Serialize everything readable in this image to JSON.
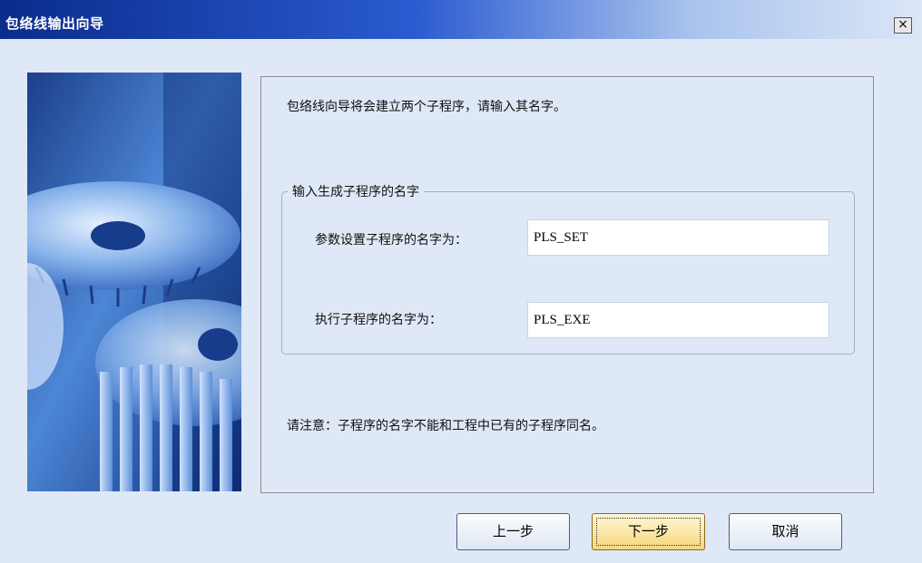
{
  "window": {
    "title": "包络线输出向导",
    "close_glyph": "×"
  },
  "intro_text": "包络线向导将会建立两个子程序，请输入其名字。",
  "group": {
    "legend": "输入生成子程序的名字",
    "set_label": "参数设置子程序的名字为：",
    "set_value": "PLS_SET",
    "exe_label": "执行子程序的名字为：",
    "exe_value": "PLS_EXE"
  },
  "note_text": "请注意：子程序的名字不能和工程中已有的子程序同名。",
  "buttons": {
    "back": "上一步",
    "next": "下一步",
    "cancel": "取消"
  },
  "colors": {
    "title_start": "#0a2c8c",
    "dialog_bg": "#dfe8f6",
    "default_button": "#f7d77a"
  },
  "illustration": "gears-image"
}
